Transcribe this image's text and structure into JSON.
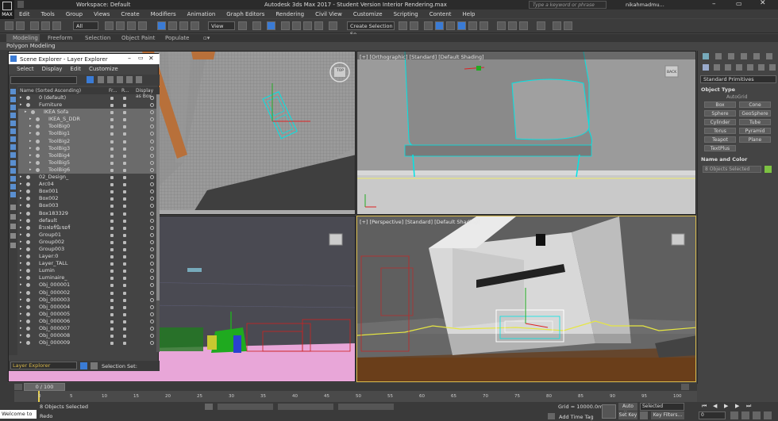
{
  "window": {
    "title": "Autodesk 3ds Max 2017 - Student Version    Interior Rendering.max",
    "workspace": "Workspace: Default",
    "search_placeholder": "Type a keyword or phrase",
    "user": "nikahmadmu..."
  },
  "menu": [
    "Edit",
    "Tools",
    "Group",
    "Views",
    "Create",
    "Modifiers",
    "Animation",
    "Graph Editors",
    "Rendering",
    "Civil View",
    "Customize",
    "Scripting",
    "Content",
    "Help"
  ],
  "toolbar": {
    "filter": "All",
    "view": "View",
    "selection_set": "Create Selection Se"
  },
  "ribbon": {
    "tabs": [
      "Modeling",
      "Freeform",
      "Selection",
      "Object Paint",
      "Populate"
    ],
    "sub": "Polygon Modeling"
  },
  "viewports": {
    "front_label": "[+] [Orthographic] [Standard] [Default Shading]",
    "persp_label": "[+] [Perspective] [Standard] [Default Shading]",
    "viewcube_front": "BACK",
    "viewcube_top": "TOP"
  },
  "scene_explorer": {
    "title": "Scene Explorer - Layer Explorer",
    "menus": [
      "Select",
      "Display",
      "Edit",
      "Customize"
    ],
    "columns": [
      "Name (Sorted Ascending)",
      "Fr...",
      "R...",
      "Display as Box"
    ],
    "rows": [
      {
        "name": "0 (default)",
        "indent": 1,
        "selected": false
      },
      {
        "name": "Furniture",
        "indent": 1,
        "selected": false
      },
      {
        "name": "IKEA Sofa",
        "indent": 2,
        "selected": true
      },
      {
        "name": "IKEA_S_DDR",
        "indent": 3,
        "selected": true
      },
      {
        "name": "ToolBig0",
        "indent": 3,
        "selected": true
      },
      {
        "name": "ToolBig1",
        "indent": 3,
        "selected": true
      },
      {
        "name": "ToolBig2",
        "indent": 3,
        "selected": true
      },
      {
        "name": "ToolBig3",
        "indent": 3,
        "selected": true
      },
      {
        "name": "ToolBig4",
        "indent": 3,
        "selected": true
      },
      {
        "name": "ToolBig5",
        "indent": 3,
        "selected": true
      },
      {
        "name": "ToolBig6",
        "indent": 3,
        "selected": true
      },
      {
        "name": "02_Design_",
        "indent": 1,
        "selected": false
      },
      {
        "name": "Arc04",
        "indent": 1,
        "selected": false
      },
      {
        "name": "Box001",
        "indent": 1,
        "selected": false
      },
      {
        "name": "Box002",
        "indent": 1,
        "selected": false
      },
      {
        "name": "Box003",
        "indent": 1,
        "selected": false
      },
      {
        "name": "Box183329",
        "indent": 1,
        "selected": false
      },
      {
        "name": "default",
        "indent": 1,
        "selected": false
      },
      {
        "name": "ผิวเฟอร์นิเจอร์",
        "indent": 1,
        "selected": false
      },
      {
        "name": "Group01",
        "indent": 1,
        "selected": false
      },
      {
        "name": "Group002",
        "indent": 1,
        "selected": false
      },
      {
        "name": "Group003",
        "indent": 1,
        "selected": false
      },
      {
        "name": "Layer:0",
        "indent": 1,
        "selected": false
      },
      {
        "name": "Layer_TALL",
        "indent": 1,
        "selected": false
      },
      {
        "name": "Lumin",
        "indent": 1,
        "selected": false
      },
      {
        "name": "Luminaire_",
        "indent": 1,
        "selected": false
      },
      {
        "name": "Obj_000001",
        "indent": 1,
        "selected": false
      },
      {
        "name": "Obj_000002",
        "indent": 1,
        "selected": false
      },
      {
        "name": "Obj_000003",
        "indent": 1,
        "selected": false
      },
      {
        "name": "Obj_000004",
        "indent": 1,
        "selected": false
      },
      {
        "name": "Obj_000005",
        "indent": 1,
        "selected": false
      },
      {
        "name": "Obj_000006",
        "indent": 1,
        "selected": false
      },
      {
        "name": "Obj_000007",
        "indent": 1,
        "selected": false
      },
      {
        "name": "Obj_000008",
        "indent": 1,
        "selected": false
      },
      {
        "name": "Obj_000009",
        "indent": 1,
        "selected": false
      }
    ],
    "footer_mode": "Layer Explorer",
    "footer_selection": "Selection Set:"
  },
  "command_panel": {
    "dropdown": "Standard Primitives",
    "object_type_title": "Object Type",
    "autogrid": "AutoGrid",
    "buttons": [
      "Box",
      "Cone",
      "Sphere",
      "GeoSphere",
      "Cylinder",
      "Tube",
      "Torus",
      "Pyramid",
      "Teapot",
      "Plane",
      "TextPlus"
    ],
    "name_color_title": "Name and Color",
    "name_value": "8 Objects Selected",
    "name_color": "#7dc242"
  },
  "timeline": {
    "frame": "0 / 100",
    "ticks": [
      "0",
      "5",
      "10",
      "15",
      "20",
      "25",
      "30",
      "35",
      "40",
      "45",
      "50",
      "55",
      "60",
      "65",
      "70",
      "75",
      "80",
      "85",
      "90",
      "95",
      "100"
    ]
  },
  "status": {
    "welcome": "Welcome to",
    "objects_selected": "8 Objects Selected",
    "redo": "Redo",
    "grid": "Grid = 10000.0mm",
    "add_time_tag": "Add Time Tag",
    "auto_key": "Auto Key",
    "set_key": "Set Key",
    "selected": "Selected",
    "key_filters": "Key Filters...",
    "frame_value": "0"
  }
}
